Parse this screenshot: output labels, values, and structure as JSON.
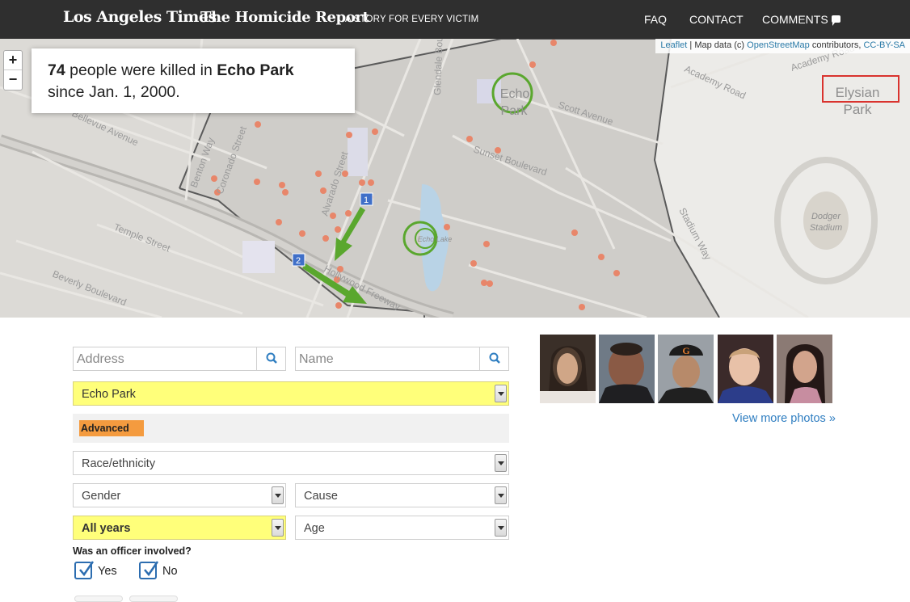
{
  "header": {
    "brand": "Los Angeles Times",
    "title": "The Homicide Report",
    "tagline": "A STORY FOR EVERY VICTIM",
    "nav": {
      "faq": "FAQ",
      "contact": "CONTACT",
      "comments": "COMMENTS"
    }
  },
  "map": {
    "zoom_in": "+",
    "zoom_out": "−",
    "attribution": {
      "leaflet": "Leaflet",
      "sep": " | Map data (c) ",
      "osm": "OpenStreetMap",
      "contrib": " contributors, ",
      "license": "CC-BY-SA"
    },
    "summary": {
      "count": "74",
      "text_mid": " people were killed in ",
      "neighborhood": "Echo Park",
      "text_end": "since Jan. 1, 2000."
    },
    "labels": {
      "echo_park": [
        "Echo",
        "Park"
      ],
      "elysian_park": [
        "Elysian",
        "Park"
      ],
      "dodger_stadium": [
        "Dodger",
        "Stadium"
      ],
      "echo_lake": "Echo Lake",
      "streets": [
        "Academy Road",
        "Scott Avenue",
        "Sunset Boulevard",
        "Alvarado Street",
        "Temple Street",
        "Beverly Boulevard",
        "Hollywood Freeway",
        "Bellevue Avenue",
        "Glendale Boulevard",
        "Stadium Way",
        "Benton Way",
        "Coronado Street"
      ]
    },
    "markers": [
      "1",
      "2"
    ]
  },
  "form": {
    "address_placeholder": "Address",
    "name_placeholder": "Name",
    "neighborhood": "Echo Park",
    "advanced": "Advanced",
    "race": "Race/ethnicity",
    "gender": "Gender",
    "cause": "Cause",
    "year": "All years",
    "age": "Age",
    "officer_question": "Was an officer involved?",
    "yes": "Yes",
    "no": "No"
  },
  "photos": {
    "view_more": "View more photos »"
  },
  "colors": {
    "highlight": "#ffff7a",
    "advanced": "#f49b3f",
    "dot": "#e8866a",
    "arrow": "#5aa72e",
    "link": "#2f7ec1"
  }
}
